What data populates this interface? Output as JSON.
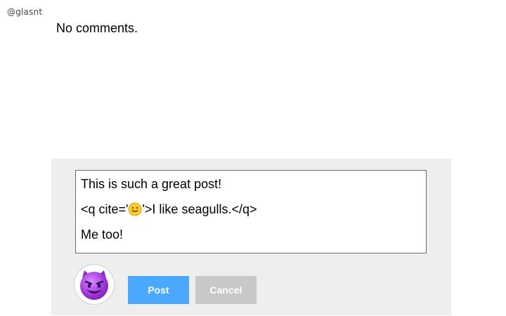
{
  "header": {
    "username": "@glasnt"
  },
  "comments": {
    "empty_text": "No comments."
  },
  "composer": {
    "lines": [
      "This is such a great post!",
      "<q cite='",
      "'>I like seagulls.</q>",
      "Me too!"
    ],
    "post_label": "Post",
    "cancel_label": "Cancel"
  },
  "icons": {
    "avatar": "smiling-devil-emoji-icon",
    "inline": "smiling-face-emoji-icon"
  },
  "colors": {
    "post_button": "#4aa8ff",
    "cancel_button": "#c8c8c8",
    "composer_bg": "#eeeeee"
  }
}
